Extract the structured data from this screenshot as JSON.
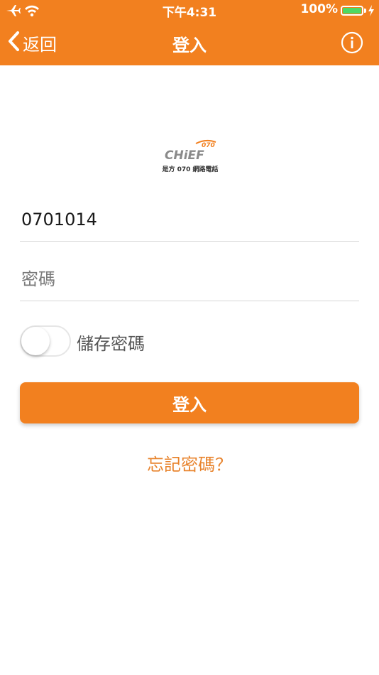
{
  "status_bar": {
    "time": "下午4:31",
    "battery_percent": "100%",
    "battery_level": 1.0,
    "icons": [
      "airplane-icon",
      "wifi-icon",
      "battery-icon",
      "charging-bolt-icon"
    ]
  },
  "navbar": {
    "back_label": "返回",
    "title": "登入",
    "info_icon": "info-icon"
  },
  "logo": {
    "brand": "CHiEF",
    "number": "070",
    "subtitle": "是方 070 網路電話"
  },
  "form": {
    "username_value": "0701014",
    "password_placeholder": "密碼",
    "save_password_label": "儲存密碼",
    "save_password_on": false,
    "login_label": "登入",
    "forgot_label": "忘記密碼？"
  },
  "colors": {
    "accent": "#f2801f",
    "link": "#e8842e",
    "battery_green": "#4cd964"
  }
}
